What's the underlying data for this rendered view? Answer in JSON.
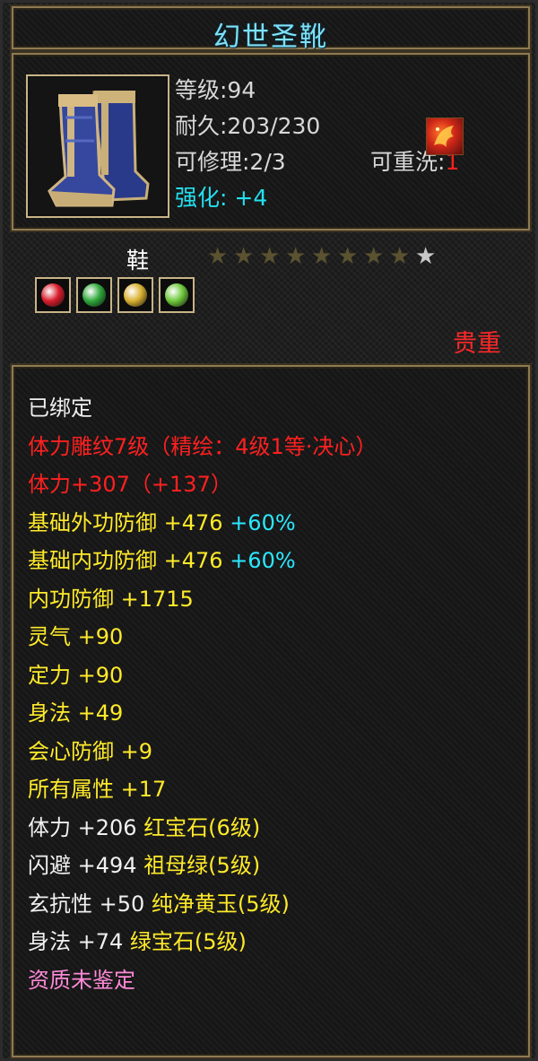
{
  "item": {
    "name": "幻世圣靴",
    "level_label": "等级:94",
    "durability_label": "耐久:203/230",
    "repair_label": "可修理:2/3",
    "rewash_label": "可重洗:",
    "rewash_value": "1",
    "enhance_label": "强化: +4",
    "icon": "blue-boots-icon",
    "badge_icon": "phoenix-emblem-icon",
    "type": "鞋",
    "stars_total": 9,
    "stars_filled": 8,
    "gem_slots": [
      {
        "name": "red-gem-icon",
        "color": "#d81c2a"
      },
      {
        "name": "green-gem-icon",
        "color": "#2ea83a"
      },
      {
        "name": "yellow-gem-icon",
        "color": "#d8b030"
      },
      {
        "name": "lightgreen-gem-icon",
        "color": "#6ec83a"
      }
    ],
    "rarity": "贵重"
  },
  "details": [
    {
      "segments": [
        {
          "text": "已绑定",
          "color": "white"
        }
      ]
    },
    {
      "segments": [
        {
          "text": "体力雕纹7级（精绘：4级1等·决心）",
          "color": "red"
        }
      ]
    },
    {
      "segments": [
        {
          "text": "体力+307（+137）",
          "color": "red"
        }
      ]
    },
    {
      "segments": [
        {
          "text": "基础外功防御 +476 ",
          "color": "yellow"
        },
        {
          "text": "+60%",
          "color": "cyan"
        }
      ]
    },
    {
      "segments": [
        {
          "text": "基础内功防御 +476 ",
          "color": "yellow"
        },
        {
          "text": "+60%",
          "color": "cyan"
        }
      ]
    },
    {
      "segments": [
        {
          "text": "内功防御 +1715",
          "color": "yellow"
        }
      ]
    },
    {
      "segments": [
        {
          "text": "灵气 +90",
          "color": "yellow"
        }
      ]
    },
    {
      "segments": [
        {
          "text": "定力 +90",
          "color": "yellow"
        }
      ]
    },
    {
      "segments": [
        {
          "text": "身法 +49",
          "color": "yellow"
        }
      ]
    },
    {
      "segments": [
        {
          "text": "会心防御 +9",
          "color": "yellow"
        }
      ]
    },
    {
      "segments": [
        {
          "text": "所有属性 +17",
          "color": "yellow"
        }
      ]
    },
    {
      "segments": [
        {
          "text": "体力 +206 ",
          "color": "white"
        },
        {
          "text": "红宝石(6级)",
          "color": "yellow"
        }
      ]
    },
    {
      "segments": [
        {
          "text": "闪避 +494 ",
          "color": "white"
        },
        {
          "text": "祖母绿(5级)",
          "color": "yellow"
        }
      ]
    },
    {
      "segments": [
        {
          "text": "玄抗性 +50 ",
          "color": "white"
        },
        {
          "text": "纯净黄玉(5级)",
          "color": "yellow"
        }
      ]
    },
    {
      "segments": [
        {
          "text": "身法 +74 ",
          "color": "white"
        },
        {
          "text": "绿宝石(5级)",
          "color": "yellow"
        }
      ]
    },
    {
      "segments": [
        {
          "text": "资质未鉴定",
          "color": "pink"
        }
      ]
    }
  ]
}
